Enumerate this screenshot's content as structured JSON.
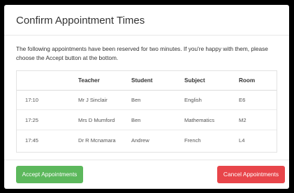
{
  "modal": {
    "title": "Confirm Appointment Times",
    "intro": "The following appointments have been reserved for two minutes. If you're happy with them, please choose the Accept button at the bottom."
  },
  "table": {
    "headers": [
      "",
      "Teacher",
      "Student",
      "Subject",
      "Room"
    ],
    "rows": [
      [
        "17:10",
        "Mr J Sinclair",
        "Ben",
        "English",
        "E6"
      ],
      [
        "17:25",
        "Mrs D Mumford",
        "Ben",
        "Mathematics",
        "M2"
      ],
      [
        "17:45",
        "Dr R Mcnamara",
        "Andrew",
        "French",
        "L4"
      ]
    ]
  },
  "footer": {
    "accept_label": "Accept Appointments",
    "cancel_label": "Cancel Appointments"
  },
  "colors": {
    "accept": "#5cb85c",
    "cancel": "#e8454a"
  }
}
